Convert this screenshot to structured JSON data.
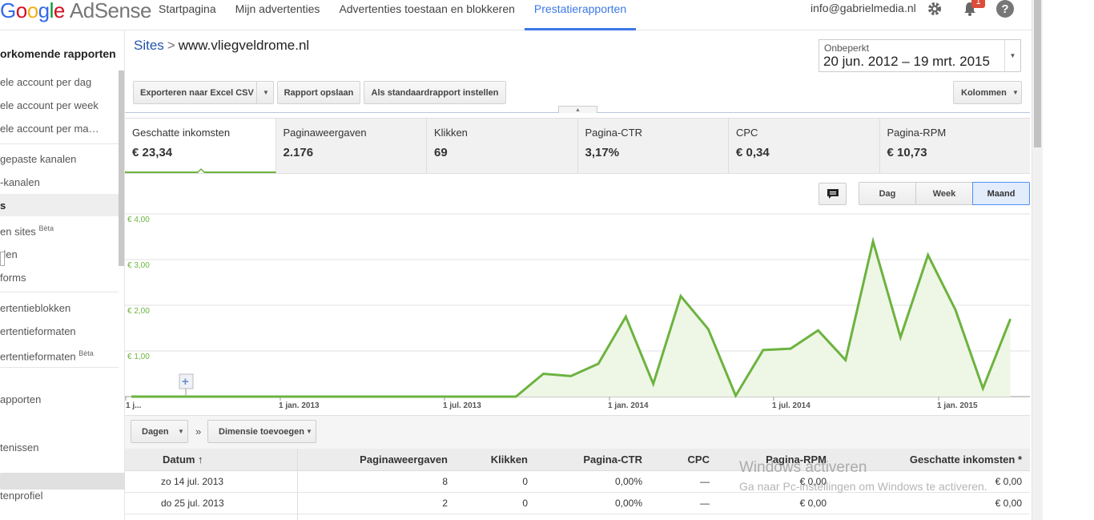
{
  "brand": {
    "google": "Google",
    "product": "AdSense"
  },
  "nav": {
    "items": [
      "Startpagina",
      "Mijn advertenties",
      "Advertenties toestaan en blokkeren",
      "Prestatierapporten"
    ],
    "active": "Prestatierapporten"
  },
  "account": {
    "email": "info@gabrielmedia.nl",
    "notification_count": "1"
  },
  "icons": {
    "settings": "gear-icon",
    "notifications": "bell-icon",
    "help": "help-icon"
  },
  "sidebar": {
    "title": "orkomende rapporten",
    "items": [
      {
        "label": "ele account per dag"
      },
      {
        "label": "ele account per week"
      },
      {
        "label": "ele account per ma…"
      },
      {
        "label": "gepaste kanalen"
      },
      {
        "label": "-kanalen"
      },
      {
        "label": "s"
      },
      {
        "label": "en sites",
        "badge": "Bèta"
      },
      {
        "label": "den"
      },
      {
        "label": "forms"
      },
      {
        "label": "ertentieblokken"
      },
      {
        "label": "ertentieformaten"
      },
      {
        "label": "ertentieformaten",
        "badge": "Bèta"
      },
      {
        "label": "apporten"
      },
      {
        "label": "tenissen"
      },
      {
        "label": "tenprofiel"
      }
    ]
  },
  "breadcrumb": {
    "root": "Sites",
    "separator": ">",
    "current": "www.vliegveldrome.nl"
  },
  "date_range": {
    "label": "Onbeperkt",
    "value": "20 jun. 2012 – 19 mrt. 2015"
  },
  "toolbar": {
    "export_label": "Exporteren naar Excel CSV",
    "save_label": "Rapport opslaan",
    "default_label": "Als standaardrapport instellen",
    "columns_label": "Kolommen"
  },
  "metrics": [
    {
      "label": "Geschatte inkomsten",
      "value": "€ 23,34"
    },
    {
      "label": "Paginaweergaven",
      "value": "2.176"
    },
    {
      "label": "Klikken",
      "value": "69"
    },
    {
      "label": "Pagina-CTR",
      "value": "3,17%"
    },
    {
      "label": "CPC",
      "value": "€ 0,34"
    },
    {
      "label": "Pagina-RPM",
      "value": "€ 10,73"
    }
  ],
  "granularity": {
    "options": [
      "Dag",
      "Week",
      "Maand"
    ],
    "active": "Maand"
  },
  "colors": {
    "accent_green": "#6cb33f",
    "nav_active": "#3b78e7",
    "badge_red": "#dd4b39"
  },
  "chart_data": {
    "type": "area",
    "title": "",
    "xlabel": "",
    "ylabel": "",
    "ylim": [
      0,
      4
    ],
    "y_ticks": [
      "€ 1,00",
      "€ 2,00",
      "€ 3,00",
      "€ 4,00"
    ],
    "x_ticks": [
      "1 j...",
      "1 jan. 2013",
      "1 jul. 2013",
      "1 jan. 2014",
      "1 jul. 2014",
      "1 jan. 2015"
    ],
    "x": [
      "2012-06",
      "2012-07",
      "2012-08",
      "2012-09",
      "2012-10",
      "2012-11",
      "2012-12",
      "2013-01",
      "2013-02",
      "2013-03",
      "2013-04",
      "2013-05",
      "2013-06",
      "2013-07",
      "2013-08",
      "2013-09",
      "2013-10",
      "2013-11",
      "2013-12",
      "2014-01",
      "2014-02",
      "2014-03",
      "2014-04",
      "2014-05",
      "2014-06",
      "2014-07",
      "2014-08",
      "2014-09",
      "2014-10",
      "2014-11",
      "2014-12",
      "2015-01",
      "2015-02",
      "2015-03"
    ],
    "series": [
      {
        "values": [
          0,
          0,
          0,
          0,
          0,
          0,
          0,
          0,
          0,
          0,
          0,
          0,
          0,
          0,
          0,
          0.5,
          0.45,
          0.72,
          1.75,
          0.28,
          2.2,
          1.48,
          0.02,
          1.02,
          1.05,
          1.45,
          0.8,
          3.4,
          1.3,
          3.1,
          1.9,
          0.18,
          1.7
        ]
      }
    ],
    "grid": true,
    "legend": "none"
  },
  "table_controls": {
    "dimension_label": "Dagen",
    "add_dimension_label": "Dimensie toevoegen",
    "chevron": "»"
  },
  "table": {
    "columns": [
      "Datum ↑",
      "Paginaweergaven",
      "Klikken",
      "Pagina-CTR",
      "CPC",
      "Pagina-RPM",
      "Geschatte inkomsten *"
    ],
    "rows": [
      [
        "zo 14 jul. 2013",
        "8",
        "0",
        "0,00%",
        "—",
        "€ 0,00",
        "€ 0,00"
      ],
      [
        "do 25 jul. 2013",
        "2",
        "0",
        "0,00%",
        "—",
        "€ 0,00",
        "€ 0,00"
      ]
    ]
  },
  "watermark": {
    "title": "Windows activeren",
    "subtitle": "Ga naar Pc-instellingen om Windows te activeren."
  }
}
